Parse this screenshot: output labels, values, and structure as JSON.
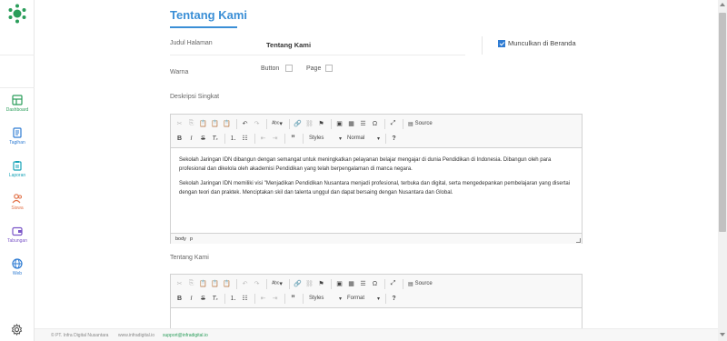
{
  "sidebar": {
    "items": [
      {
        "label": "Dashboard",
        "icon": "dashboard-icon",
        "color": "#2a9d5a"
      },
      {
        "label": "Tagihan",
        "icon": "invoice-icon",
        "color": "#2f7cd3"
      },
      {
        "label": "Laporan",
        "icon": "clipboard-icon",
        "color": "#18a3b8"
      },
      {
        "label": "Siswa",
        "icon": "users-icon",
        "color": "#e2734a"
      },
      {
        "label": "Tabungan",
        "icon": "wallet-icon",
        "color": "#7b55c7"
      },
      {
        "label": "Web",
        "icon": "globe-icon",
        "color": "#2f7cd3"
      }
    ],
    "settings_icon": "gear-icon"
  },
  "page": {
    "title": "Tentang Kami",
    "judul_label": "Judul Halaman",
    "judul_value": "Tentang Kami",
    "show_home_label": "Munculkan di Beranda",
    "show_home_checked": true,
    "warna_label": "Warna",
    "button_label": "Button",
    "page_label": "Page",
    "deskripsi_label": "Deskripsi Singkat",
    "tentang_label": "Tentang Kami"
  },
  "editor": {
    "source_label": "Source",
    "styles_label": "Styles",
    "format1_value": "Normal",
    "format2_value": "Format",
    "path_body": "body",
    "path_p": "p",
    "para1": "Sekolah Jaringan IDN dibangun dengan semangat untuk meningkatkan pelayanan belajar mengajar di dunia Pendidikan di Indonesia. Dibangun oleh para profesional dan dikelola oleh akademisi Pendidikan yang telah berpengalaman di manca negara.",
    "para2": "Sekolah Jaringan IDN memiliki visi \"Menjadikan Pendidikan Nusantara menjadi profesional, terbuka dan digital, serta mengedepankan pembelajaran yang disertai dengan teori dan praktek. Menciptakan skil dan talenta unggul dan dapat bersaing dengan Nusantara dan Global."
  },
  "footer": {
    "company": "© PT. Infra Digital Nusantara",
    "website": "www.infradigital.io",
    "email": "support@infradigital.io"
  },
  "colors": {
    "accent": "#3b8fd6",
    "check": "#2f7cd3"
  }
}
